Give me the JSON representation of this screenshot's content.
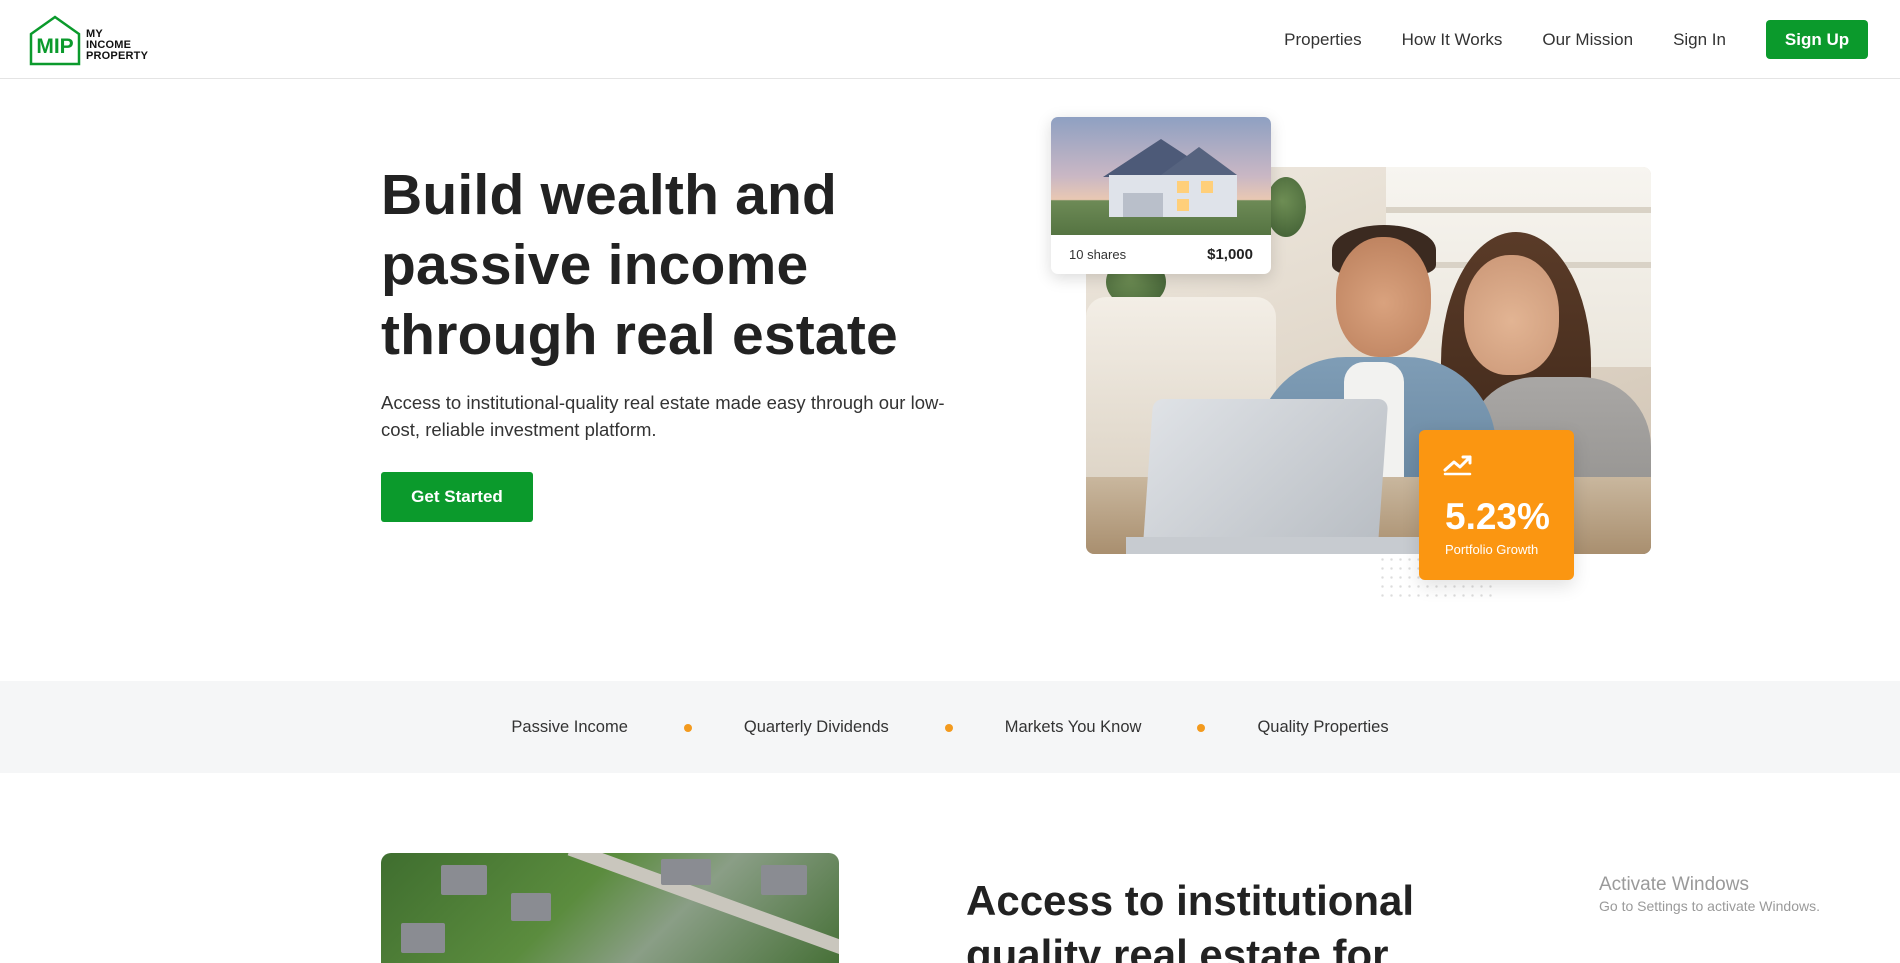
{
  "brand": {
    "initials": "MIP",
    "line1": "MY",
    "line2": "INCOME",
    "line3": "PROPERTY",
    "color": "#0b9a2c"
  },
  "nav": {
    "links": [
      "Properties",
      "How It Works",
      "Our Mission",
      "Sign In"
    ],
    "signup_label": "Sign Up"
  },
  "hero": {
    "title": "Build wealth and passive income through real estate",
    "subtitle": "Access to institutional-quality real estate made easy through our low-cost, reliable investment platform.",
    "cta_label": "Get Started"
  },
  "shares_card": {
    "label": "10 shares",
    "amount": "$1,000"
  },
  "growth_card": {
    "icon": "trending-up-icon",
    "value": "5.23%",
    "label": "Portfolio Growth",
    "color": "#fb9611"
  },
  "features": {
    "items": [
      "Passive Income",
      "Quarterly Dividends",
      "Markets You Know",
      "Quality Properties"
    ],
    "dot_color": "#f39a1e"
  },
  "section2": {
    "title": "Access to institutional quality real estate for"
  },
  "watermark": {
    "title": "Activate Windows",
    "subtitle": "Go to Settings to activate Windows."
  }
}
